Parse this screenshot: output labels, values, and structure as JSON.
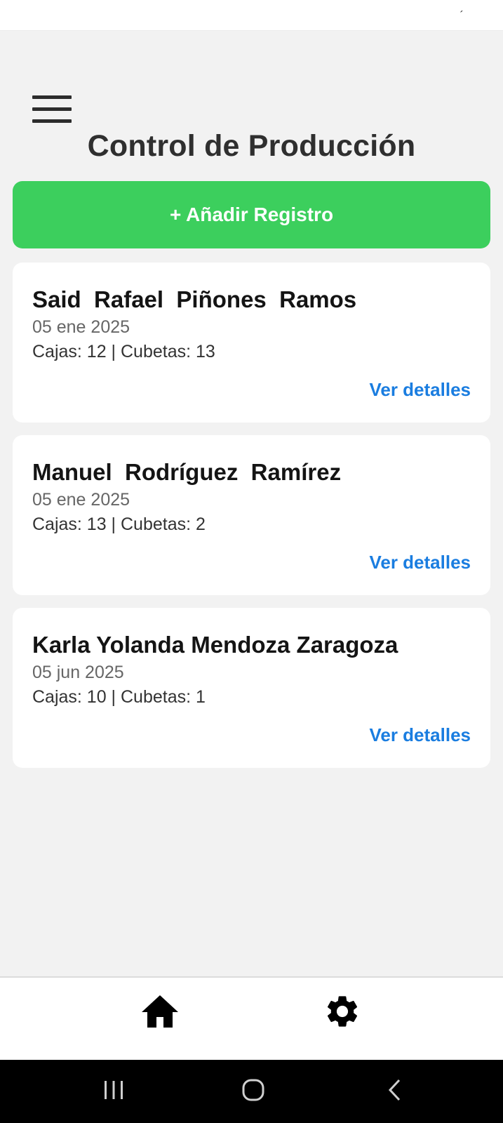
{
  "status_bar": {
    "mark": "´"
  },
  "header": {
    "title": "Control de Producción"
  },
  "actions": {
    "add_label": "+ Añadir Registro"
  },
  "records": [
    {
      "name": "Said  Rafael  Piñones  Ramos",
      "date": "05 ene 2025",
      "counts": "Cajas: 12 | Cubetas: 13",
      "details_label": "Ver detalles"
    },
    {
      "name": "Manuel  Rodríguez  Ramírez",
      "date": "05 ene 2025",
      "counts": "Cajas: 13 | Cubetas: 2",
      "details_label": "Ver detalles"
    },
    {
      "name": "Karla Yolanda Mendoza Zaragoza",
      "date": "05 jun 2025",
      "counts": "Cajas: 10 | Cubetas: 1",
      "details_label": "Ver detalles"
    }
  ],
  "bottom_nav": {
    "items": [
      "home-icon",
      "gear-icon"
    ]
  },
  "system_nav": {
    "items": [
      "recents-icon",
      "home-circle-icon",
      "back-icon"
    ]
  },
  "colors": {
    "accent_green": "#3ccf5d",
    "link_blue": "#1a7de0",
    "background": "#f2f2f2"
  }
}
